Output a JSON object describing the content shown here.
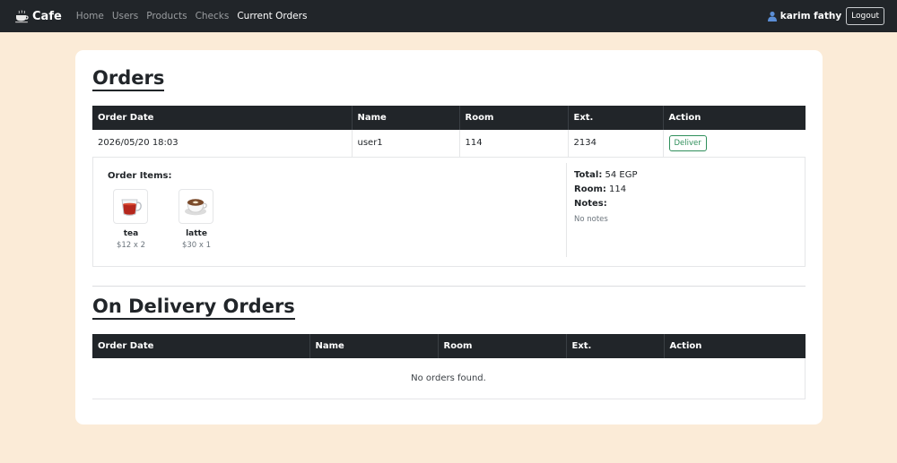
{
  "nav": {
    "brand": "Cafe",
    "links": [
      "Home",
      "Users",
      "Products",
      "Checks",
      "Current Orders"
    ],
    "user": "karim fathy",
    "logout": "Logout"
  },
  "orders": {
    "title": "Orders",
    "columns": [
      "Order Date",
      "Name",
      "Room",
      "Ext.",
      "Action"
    ],
    "row": {
      "date": "2026/05/20 18:03",
      "name": "user1",
      "room": "114",
      "ext": "2134",
      "action": "Deliver"
    },
    "details": {
      "items_label": "Order Items:",
      "items": [
        {
          "name": "tea",
          "price": "$12 x 2",
          "icon": "tea-cup-icon"
        },
        {
          "name": "latte",
          "price": "$30 x 1",
          "icon": "latte-cup-icon"
        }
      ],
      "total_label": "Total:",
      "total_value": "54 EGP",
      "room_label": "Room:",
      "room_value": "114",
      "notes_label": "Notes:",
      "notes_value": "No notes"
    }
  },
  "delivery": {
    "title": "On Delivery Orders",
    "columns": [
      "Order Date",
      "Name",
      "Room",
      "Ext.",
      "Action"
    ],
    "empty": "No orders found."
  },
  "colors": {
    "navbar": "#212529",
    "page_bg": "#fbebd7",
    "deliver_accent": "#2f8f5b"
  }
}
